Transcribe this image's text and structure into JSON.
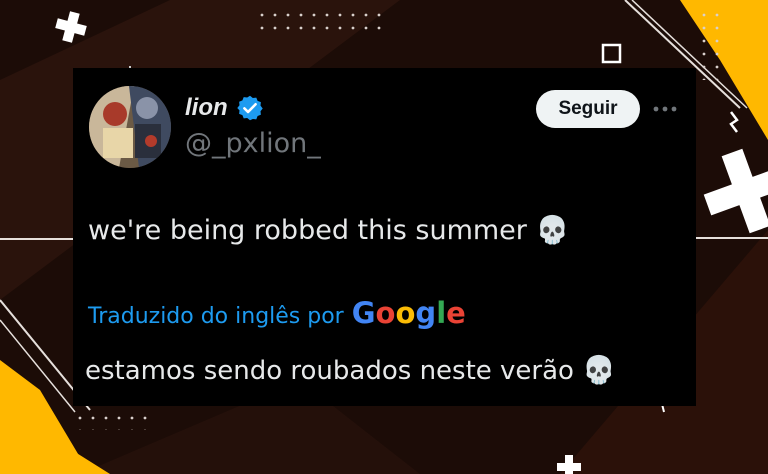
{
  "tweet": {
    "display_name": "lion",
    "handle": "@_pxlion_",
    "follow_label": "Seguir",
    "text": "we're being robbed this summer",
    "emoji": "💀",
    "translation_label": "Traduzido do inglês por",
    "translation_provider": "Google",
    "translated_text": "estamos sendo roubados neste verão",
    "icons": [
      "verified-badge-icon",
      "more-icon",
      "skull-emoji"
    ]
  },
  "colors": {
    "background": "#1c0c07",
    "accent_yellow": "#ffb800",
    "card": "#000000",
    "verified": "#1d9bf0",
    "link_blue": "#1d9bf0",
    "follow_button": "#eff3f4",
    "google_blue": "#4285f4",
    "google_red": "#ea4335",
    "google_yellow": "#fbbc05",
    "google_green": "#34a853"
  }
}
